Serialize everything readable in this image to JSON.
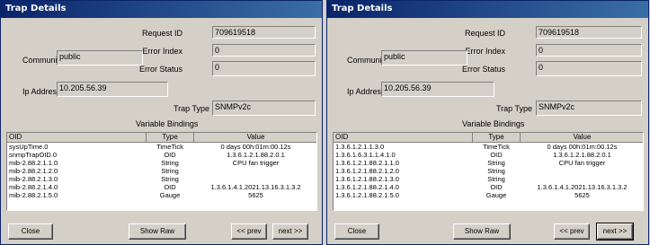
{
  "windows": [
    {
      "title": "Trap Details",
      "labels": {
        "request_id": "Request ID",
        "error_index": "Error Index",
        "error_status": "Error Status",
        "community": "Community",
        "ip_address": "Ip Address",
        "trap_type": "Trap Type",
        "variable_bindings": "Variable Bindings"
      },
      "values": {
        "request_id": "709619518",
        "error_index": "0",
        "error_status": "0",
        "community": "public",
        "ip_address": "10.205.56.39",
        "trap_type": "SNMPv2c"
      },
      "table": {
        "headers": [
          "OID",
          "Type",
          "Value"
        ],
        "rows": [
          [
            "sysUpTime.0",
            "TimeTick",
            "0 days 00h:01m:00.12s"
          ],
          [
            "snmpTrapOID.0",
            "OID",
            "1.3.6.1.2.1.88.2.0.1"
          ],
          [
            "mib-2.88.2.1.1.0",
            "String",
            "CPU fan trigger"
          ],
          [
            "mib-2.88.2.1.2.0",
            "String",
            ""
          ],
          [
            "mib-2.88.2.1.3.0",
            "String",
            ""
          ],
          [
            "mib-2.88.2.1.4.0",
            "OID",
            "1.3.6.1.4.1.2021.13.16.3.1.3.2"
          ],
          [
            "mib-2.88.2.1.5.0",
            "Gauge",
            "5625"
          ]
        ]
      },
      "buttons": {
        "close": "Close",
        "show_raw": "Show Raw",
        "prev": "<< prev",
        "next": "next >>"
      }
    },
    {
      "title": "Trap Details",
      "labels": {
        "request_id": "Request ID",
        "error_index": "Error Index",
        "error_status": "Error Status",
        "community": "Community",
        "ip_address": "Ip Address",
        "trap_type": "Trap Type",
        "variable_bindings": "Variable Bindings"
      },
      "values": {
        "request_id": "709619518",
        "error_index": "0",
        "error_status": "0",
        "community": "public",
        "ip_address": "10.205.56.39",
        "trap_type": "SNMPv2c"
      },
      "table": {
        "headers": [
          "OID",
          "Type",
          "Value"
        ],
        "rows": [
          [
            "1.3.6.1.2.1.1.3.0",
            "TimeTick",
            "0 days 00h:01m:00.12s"
          ],
          [
            "1.3.6.1.6.3.1.1.4.1.0",
            "OID",
            "1.3.6.1.2.1.88.2.0.1"
          ],
          [
            "1.3.6.1.2.1.88.2.1.1.0",
            "String",
            "CPU fan trigger"
          ],
          [
            "1.3.6.1.2.1.88.2.1.2.0",
            "String",
            ""
          ],
          [
            "1.3.6.1.2.1.88.2.1.3.0",
            "String",
            ""
          ],
          [
            "1.3.6.1.2.1.88.2.1.4.0",
            "OID",
            "1.3.6.1.4.1.2021.13.16.3.1.3.2"
          ],
          [
            "1.3.6.1.2.1.88.2.1.5.0",
            "Gauge",
            "5625"
          ]
        ]
      },
      "buttons": {
        "close": "Close",
        "show_raw": "Show Raw",
        "prev": "<< prev",
        "next": "next >>"
      }
    }
  ]
}
